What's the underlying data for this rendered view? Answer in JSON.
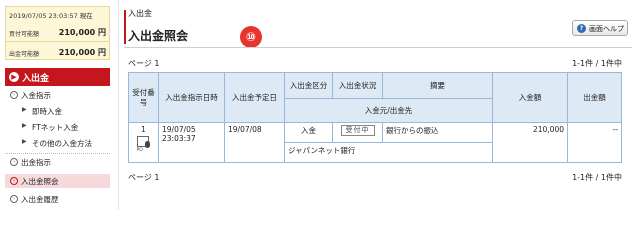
{
  "balance": {
    "datetime": "2019/07/05 23:03:57 現在",
    "buying_power_label": "買付可能額",
    "buying_power_value": "210,000 円",
    "withdrawable_label": "出金可能額",
    "withdrawable_value": "210,000 円"
  },
  "sidebar": {
    "section_title": "入出金",
    "items": [
      {
        "label": "入金指示"
      },
      {
        "label": "即時入金"
      },
      {
        "label": "FTネット入金"
      },
      {
        "label": "その他の入金方法"
      },
      {
        "label": "出金指示"
      },
      {
        "label": "入出金照会"
      },
      {
        "label": "入出金履歴"
      }
    ],
    "active_item": "入出金照会"
  },
  "header": {
    "breadcrumb": "入出金",
    "title": "入出金照会",
    "step_number": "⑩",
    "help_label": "画面ヘルプ"
  },
  "pager_top": {
    "page": "ページ 1",
    "count": "1-1件 / 1件中"
  },
  "pager_bottom": {
    "page": "ページ 1",
    "count": "1-1件 / 1件中"
  },
  "table": {
    "headers": {
      "receipt_no": "受付番号",
      "order_datetime": "入出金指示日時",
      "scheduled_date": "入出金予定日",
      "category": "入出金区分",
      "status": "入出金状況",
      "summary": "摘要",
      "counterparty": "入金元/出金先",
      "deposit_amount": "入金額",
      "withdraw_amount": "出金額"
    },
    "rows": [
      {
        "receipt_no": "1",
        "icon_caption": "PO",
        "order_date": "19/07/05",
        "order_time": "23:03:37",
        "scheduled_date": "19/07/08",
        "category": "入金",
        "status": "受付中",
        "summary": "銀行からの振込",
        "counterparty": "ジャパンネット銀行",
        "deposit_amount": "210,000",
        "withdraw_amount": "--"
      }
    ]
  },
  "colors": {
    "accent_red": "#c4161c",
    "header_blue": "#dde9f5",
    "balance_bg": "#fdf7d8",
    "badge_red": "#e8342f"
  }
}
